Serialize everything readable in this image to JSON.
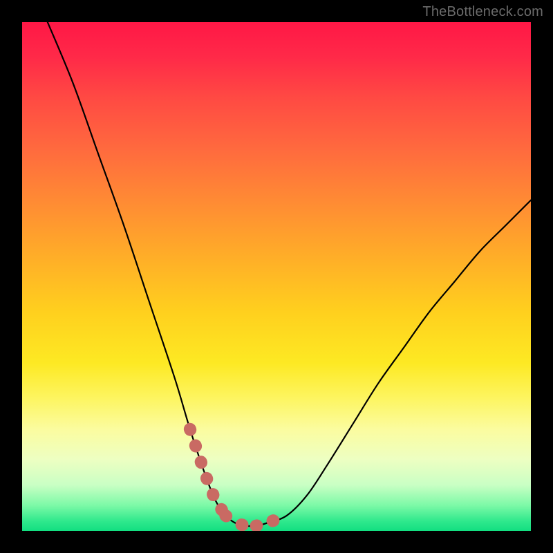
{
  "watermark": "TheBottleneck.com",
  "chart_data": {
    "type": "line",
    "title": "",
    "xlabel": "",
    "ylabel": "",
    "xlim": [
      0,
      100
    ],
    "ylim": [
      0,
      100
    ],
    "series": [
      {
        "name": "bottleneck-curve",
        "x": [
          5,
          10,
          15,
          20,
          25,
          30,
          33,
          36,
          38,
          40,
          42,
          44,
          46,
          48,
          52,
          56,
          60,
          65,
          70,
          75,
          80,
          85,
          90,
          95,
          100
        ],
        "values": [
          100,
          88,
          74,
          60,
          45,
          30,
          20,
          11,
          6,
          3,
          1.5,
          1,
          1,
          1.5,
          3,
          7,
          13,
          21,
          29,
          36,
          43,
          49,
          55,
          60,
          65
        ]
      }
    ],
    "marker_ranges": [
      {
        "name": "left-shoulder",
        "x": [
          33,
          40
        ],
        "color": "#c96a63"
      },
      {
        "name": "right-shoulder",
        "x": [
          46,
          51
        ],
        "color": "#c96a63"
      }
    ],
    "background_gradient": {
      "top": "#ff1746",
      "mid": "#fde923",
      "bottom": "#12df81"
    }
  }
}
